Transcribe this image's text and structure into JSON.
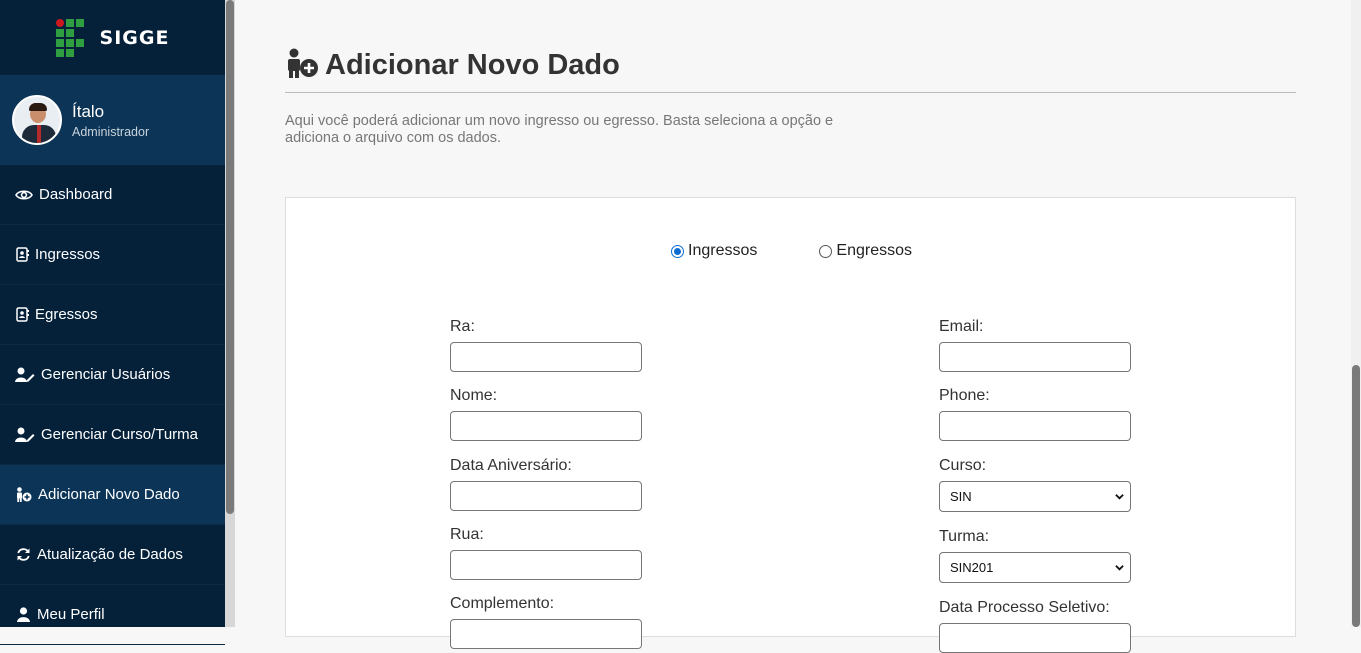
{
  "brand": {
    "name": "SIGGE"
  },
  "user": {
    "name": "Ítalo",
    "role": "Administrador"
  },
  "nav": [
    {
      "label": "Dashboard",
      "icon": "eye-icon"
    },
    {
      "label": "Ingressos",
      "icon": "contact-book-icon"
    },
    {
      "label": "Egressos",
      "icon": "contact-book-icon"
    },
    {
      "label": "Gerenciar Usuários",
      "icon": "user-edit-icon"
    },
    {
      "label": "Gerenciar Curso/Turma",
      "icon": "user-edit-icon"
    },
    {
      "label": "Adicionar Novo Dado",
      "icon": "user-add-icon",
      "active": true
    },
    {
      "label": "Atualização de Dados",
      "icon": "sync-icon"
    },
    {
      "label": "Meu Perfil",
      "icon": "user-icon"
    }
  ],
  "page": {
    "title": "Adicionar Novo Dado",
    "title_icon": "user-add-icon",
    "description": "Aqui você poderá adicionar um novo ingresso ou egresso. Basta seleciona a opção e adiciona o arquivo com os dados."
  },
  "form": {
    "radios": [
      {
        "label": "Ingressos",
        "checked": true
      },
      {
        "label": "Engressos",
        "checked": false
      }
    ],
    "left_fields": [
      {
        "label": "Ra:",
        "value": ""
      },
      {
        "label": "Nome:",
        "value": ""
      },
      {
        "label": "Data Aniversário:",
        "value": ""
      },
      {
        "label": "Rua:",
        "value": ""
      },
      {
        "label": "Complemento:",
        "value": ""
      }
    ],
    "right_fields": [
      {
        "label": "Email:",
        "value": ""
      },
      {
        "label": "Phone:",
        "value": ""
      },
      {
        "label": "Curso:",
        "selected": "SIN"
      },
      {
        "label": "Turma:",
        "selected": "SIN201"
      },
      {
        "label": "Data Processo Seletivo:",
        "value": ""
      }
    ]
  },
  "colors": {
    "sidebar": "#05213a",
    "sidebar_active": "#0b3457",
    "accent": "#0b6bd3",
    "logo_green": "#2f9e41",
    "logo_red": "#cd191e"
  }
}
